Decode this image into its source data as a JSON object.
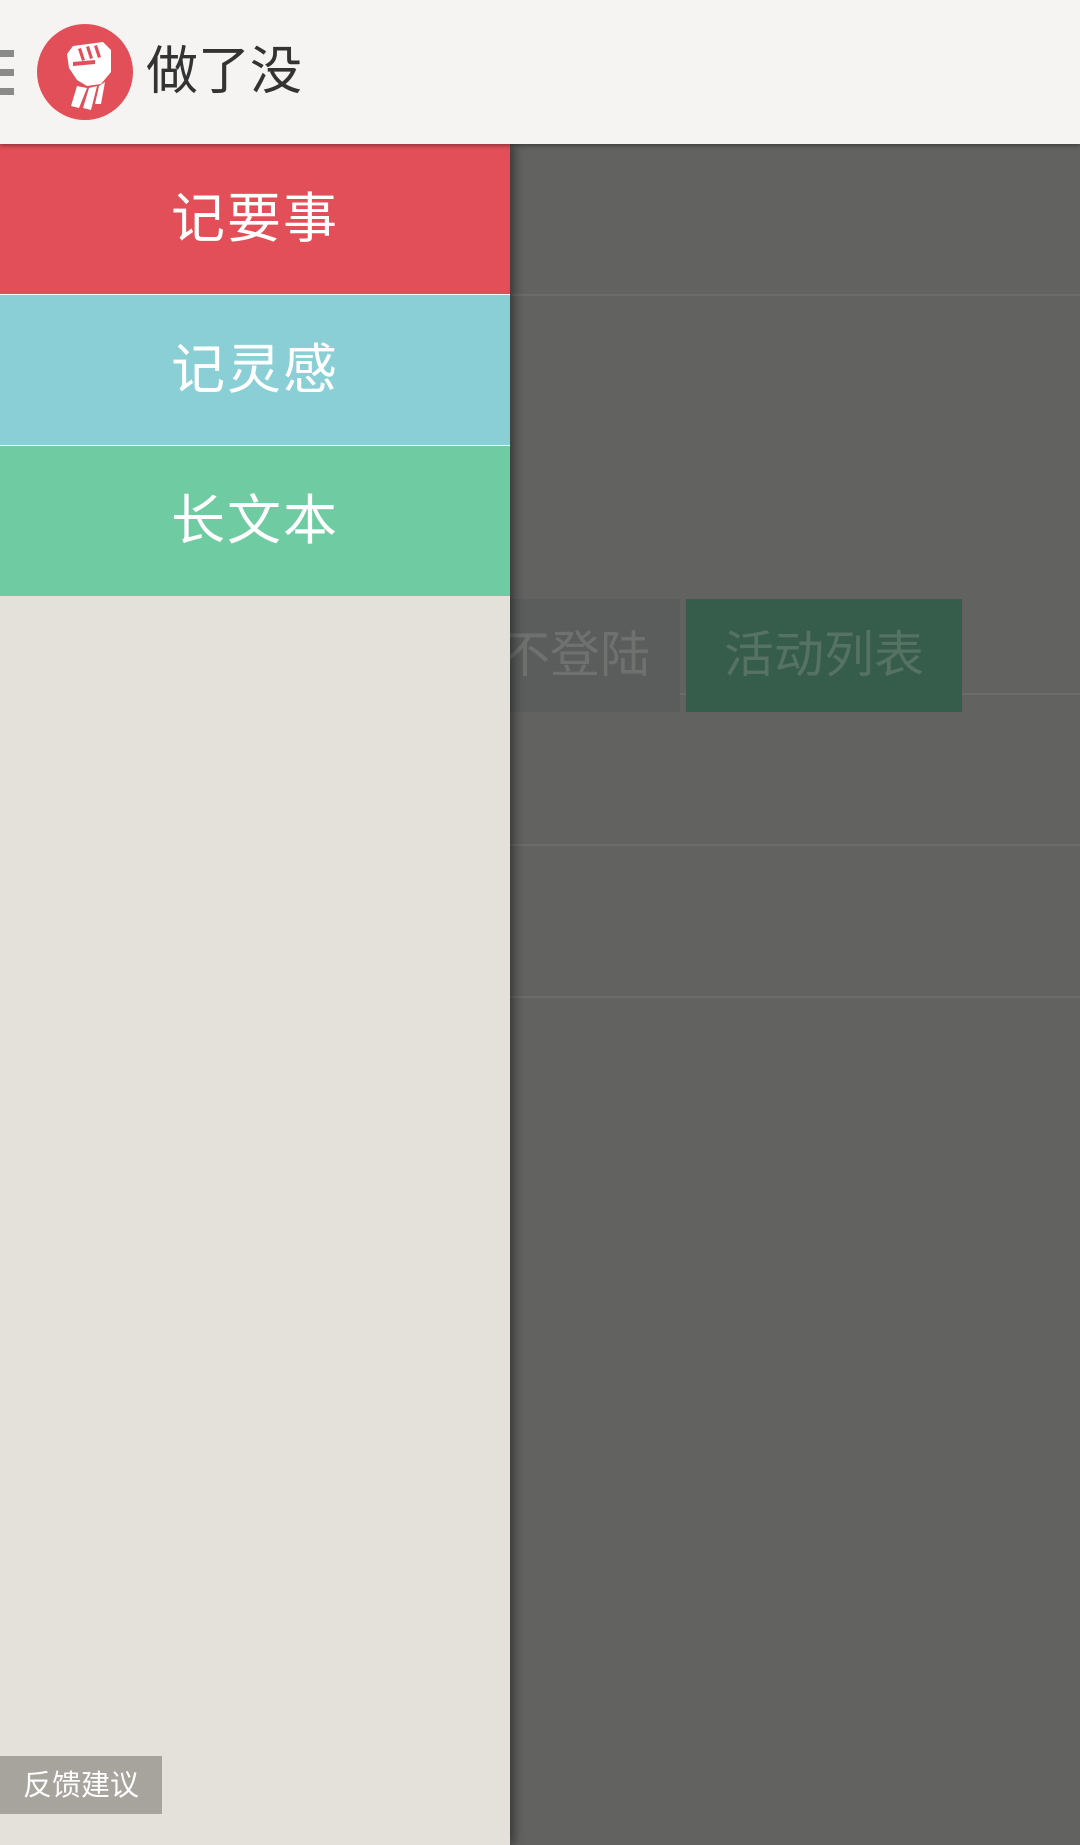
{
  "app": {
    "title": "做了没",
    "logo_icon": "raised-fist-icon",
    "brand_color": "#e24f58"
  },
  "background": {
    "buttons": {
      "no_login": "不登陆",
      "activity_list": "活动列表"
    }
  },
  "drawer": {
    "items": [
      {
        "label": "记要事",
        "color": "#e24f58"
      },
      {
        "label": "记灵感",
        "color": "#8acfd6"
      },
      {
        "label": "长文本",
        "color": "#6fcba2"
      }
    ],
    "feedback_label": "反馈建议"
  }
}
